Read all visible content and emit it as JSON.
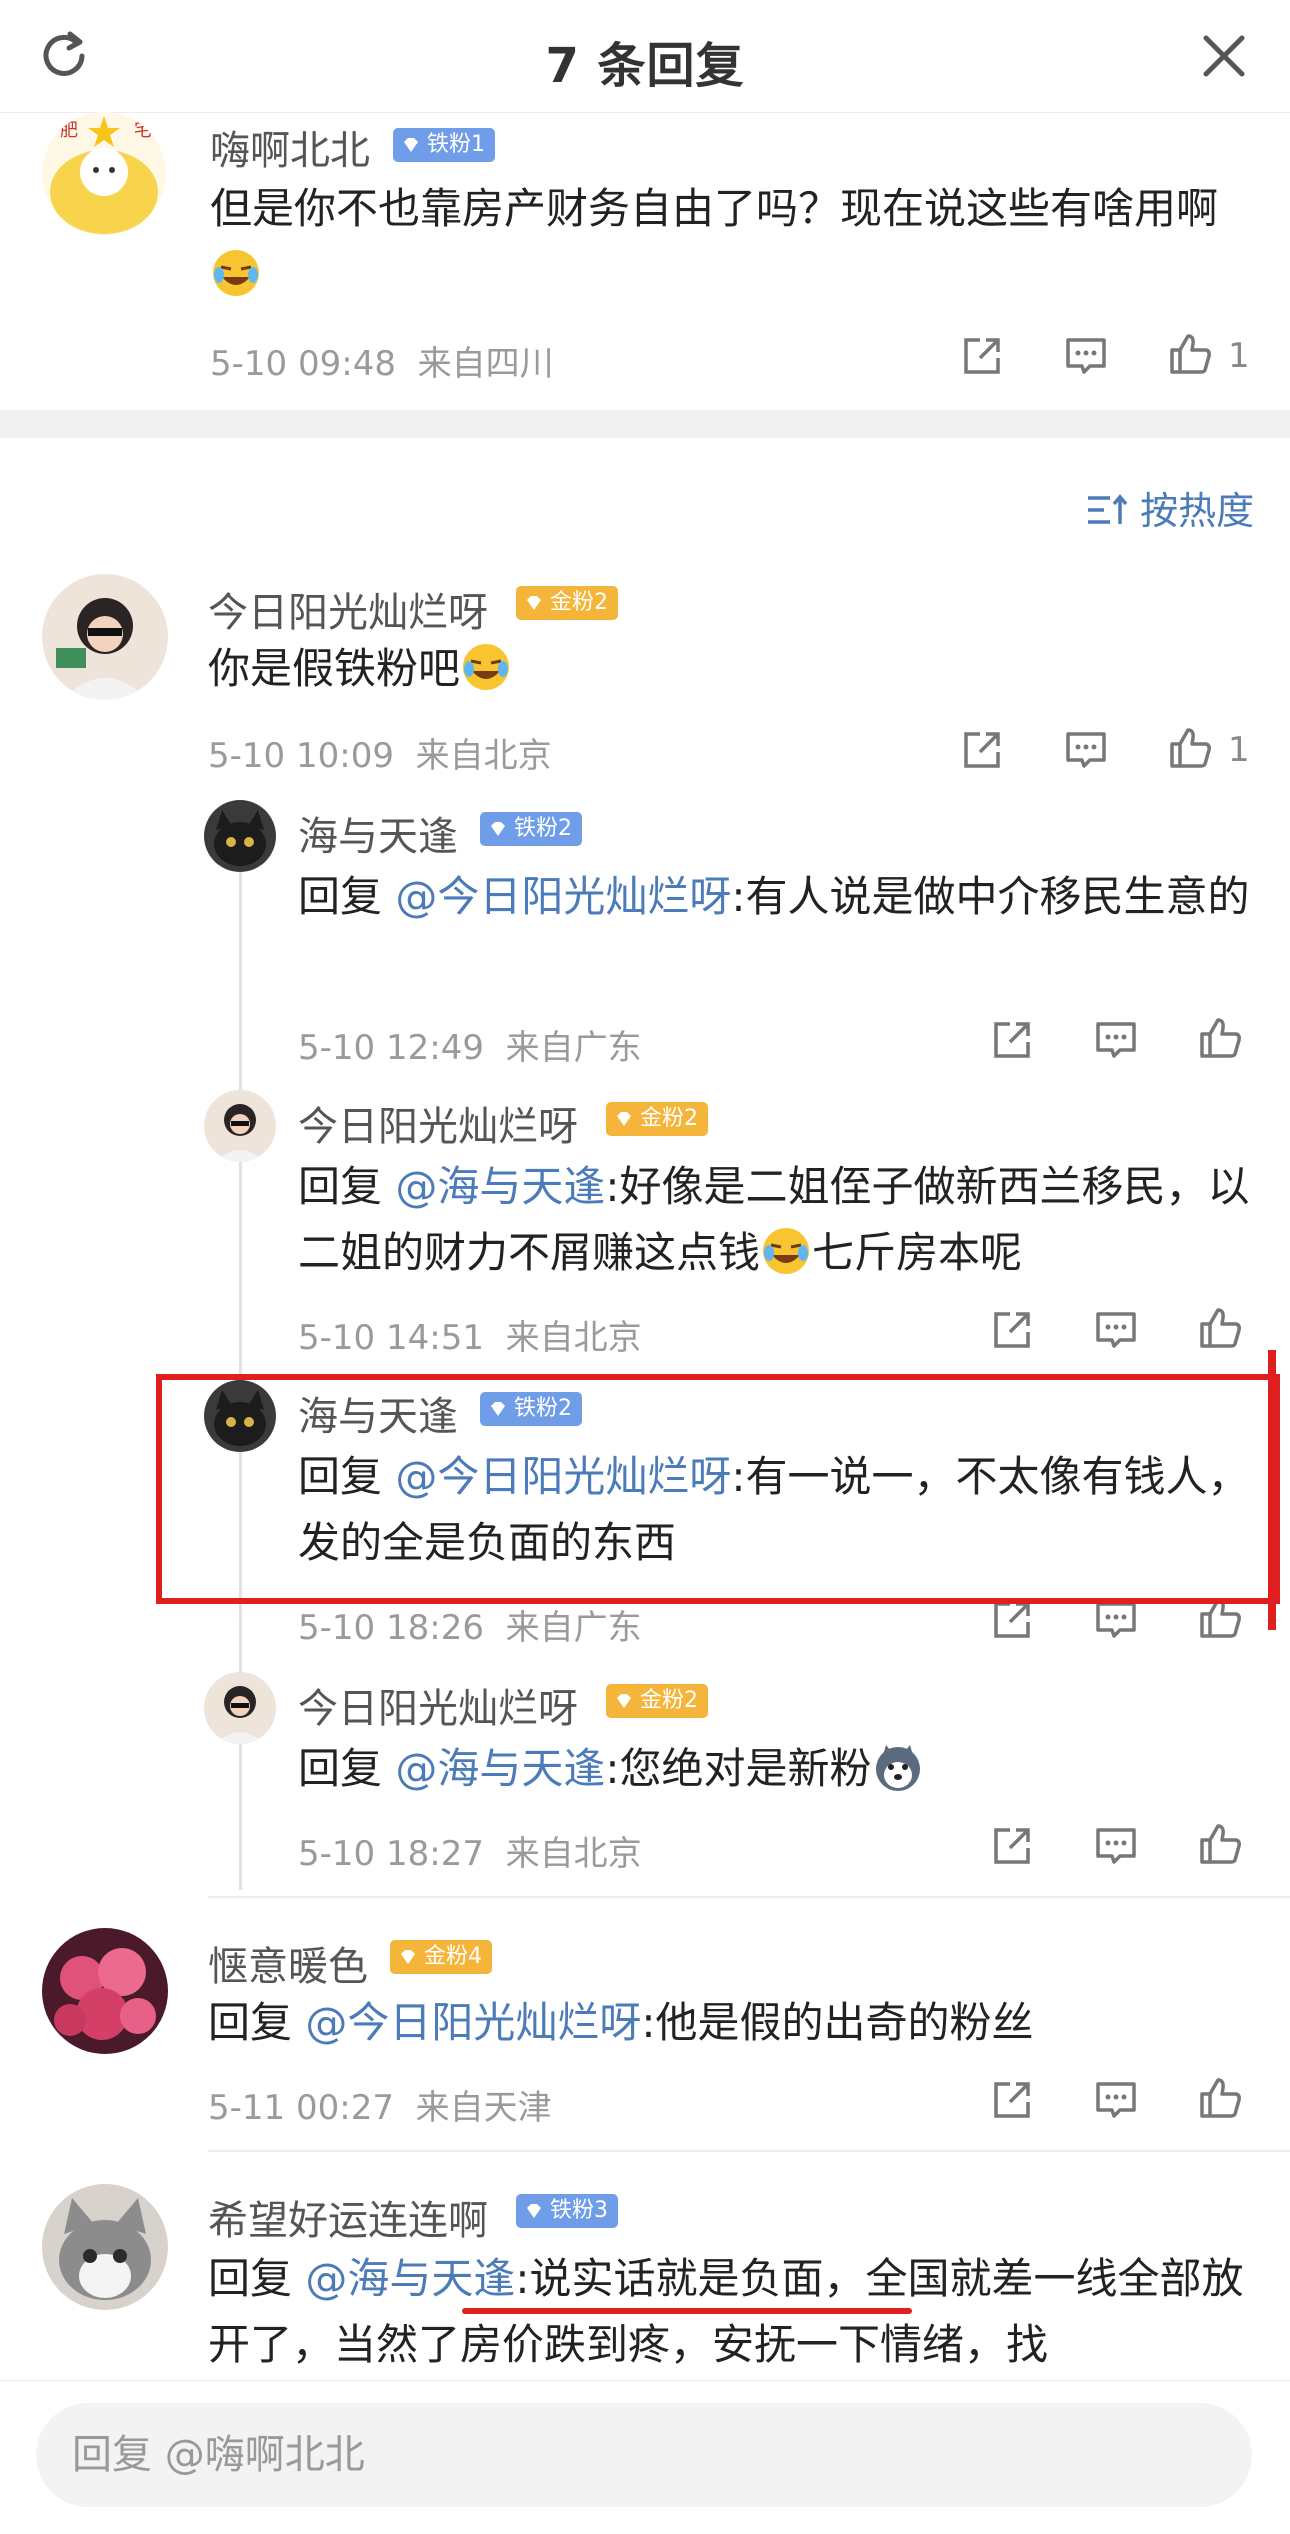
{
  "header": {
    "title": "7 条回复",
    "refresh_icon": "refresh-icon",
    "close_icon": "close-icon"
  },
  "root_comment": {
    "user": "嗨啊北北",
    "badge": "铁粉1",
    "text": "但是你不也靠房产财务自由了吗？现在说这些有啥用啊",
    "emoji": "laugh-cry-emoji",
    "time": "5-10 09:48",
    "location": "来自四川",
    "likes": "1"
  },
  "sort": {
    "label": "按热度",
    "icon": "sort-icon"
  },
  "comments": [
    {
      "user": "今日阳光灿烂呀",
      "badge": "金粉2",
      "text": "你是假铁粉吧",
      "time": "5-10 10:09",
      "location": "来自北京",
      "likes": "1"
    },
    {
      "user": "海与天逢",
      "badge": "铁粉2",
      "reply_prefix": "回复 ",
      "mention": "@今日阳光灿烂呀",
      "text": ":有人说是做中介移民生意的",
      "time": "5-10 12:49",
      "location": "来自广东"
    },
    {
      "user": "今日阳光灿烂呀",
      "badge": "金粉2",
      "reply_prefix": "回复 ",
      "mention": "@海与天逢",
      "text": ":好像是二姐侄子做新西兰移民，以二姐的财力不屑赚这点钱",
      "text_tail": "七斤房本呢",
      "time": "5-10 14:51",
      "location": "来自北京"
    },
    {
      "user": "海与天逢",
      "badge": "铁粉2",
      "reply_prefix": "回复 ",
      "mention": "@今日阳光灿烂呀",
      "text": ":有一说一，不太像有钱人，发的全是负面的东西",
      "time": "5-10 18:26",
      "location": "来自广东"
    },
    {
      "user": "今日阳光灿烂呀",
      "badge": "金粉2",
      "reply_prefix": "回复 ",
      "mention": "@海与天逢",
      "text": ":您绝对是新粉",
      "time": "5-10 18:27",
      "location": "来自北京"
    },
    {
      "user": "惬意暖色",
      "badge": "金粉4",
      "reply_prefix": "回复 ",
      "mention": "@今日阳光灿烂呀",
      "text": ":他是假的出奇的粉丝",
      "time": "5-11 00:27",
      "location": "来自天津"
    },
    {
      "user": "希望好运连连啊",
      "badge": "铁粉3",
      "reply_prefix": "回复 ",
      "mention": "@海与天逢",
      "text": ":说实话就是负面，全国就差一线全部放开了，当然了房价跌到疼，安抚一下情绪，找"
    }
  ],
  "reply_bar": {
    "placeholder": "回复 @嗨啊北北"
  },
  "colors": {
    "mention": "#4b7bb8",
    "iron_badge": "#6f9de8",
    "gold_badge": "#f5b43a",
    "annotation_red": "#e01f1f"
  }
}
